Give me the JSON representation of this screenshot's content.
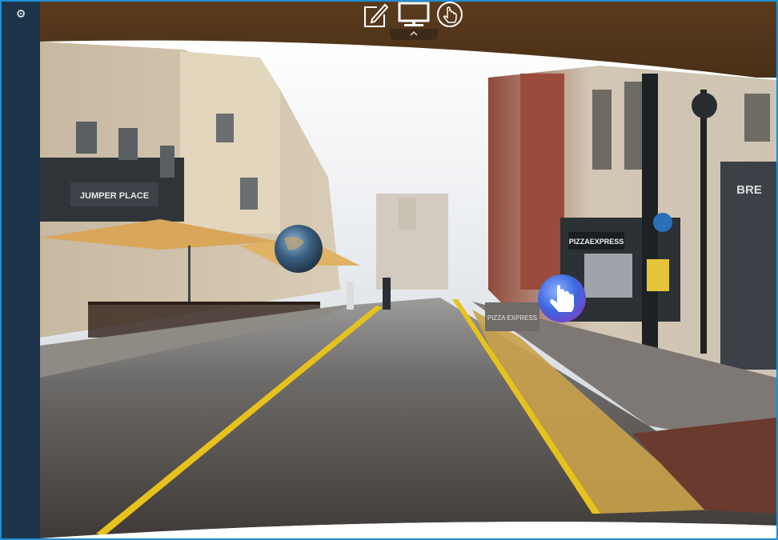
{
  "sidebar": {
    "settings_icon": "gear-icon",
    "settings_glyph": "⚙"
  },
  "toolbar": {
    "icons": [
      "edit-icon",
      "monitor-icon",
      "touch-icon"
    ],
    "active_indicator": "chevron-up-icon"
  },
  "scene": {
    "signs": {
      "left_shop": "JUMPER PLACE",
      "pizza_shop": "PIZZAEXPRESS",
      "pizza_board": "PIZZA EXPRESS",
      "right_shop": "BRE"
    },
    "hotspots": [
      "globe-hotspot",
      "hand-hotspot"
    ]
  },
  "colors": {
    "sidebar": "#1c3349",
    "frame_border": "#1d8fd6",
    "ceiling": "#4f3319",
    "hotspot_hand": "#3b66e0"
  }
}
